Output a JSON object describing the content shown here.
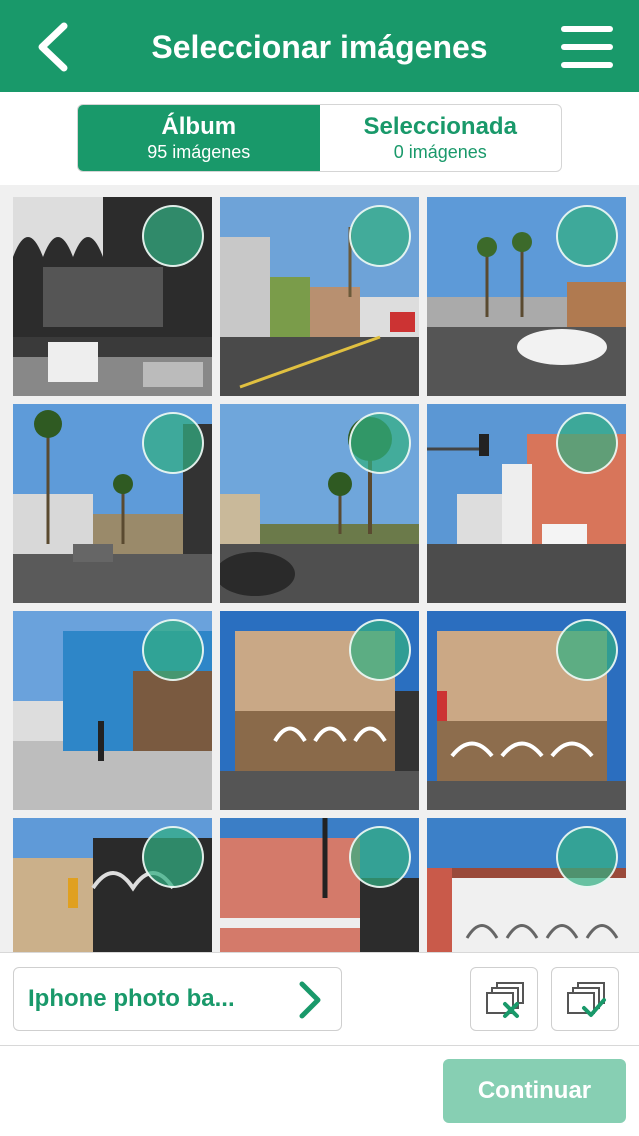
{
  "header": {
    "title": "Seleccionar imágenes",
    "background_color": "#19996a",
    "back_icon": "chevron-left-icon",
    "menu_icon": "hamburger-menu-icon"
  },
  "tabs": [
    {
      "label": "Álbum",
      "count_text": "95 imágenes",
      "active": true
    },
    {
      "label": "Seleccionada",
      "count_text": "0 imágenes",
      "active": false
    }
  ],
  "grid": {
    "thumbnails": [
      {
        "scene": "mural wall with arches and parked cars",
        "selected": false
      },
      {
        "scene": "street with palm trees and buildings",
        "selected": false
      },
      {
        "scene": "road with palm trees and white car",
        "selected": false
      },
      {
        "scene": "palm trees along street",
        "selected": false
      },
      {
        "scene": "street with palm tree and parked car",
        "selected": false
      },
      {
        "scene": "intersection with colorful buildings",
        "selected": false
      },
      {
        "scene": "blue arcade building",
        "selected": false
      },
      {
        "scene": "arched brick building",
        "selected": false
      },
      {
        "scene": "arched brick building with awning",
        "selected": false
      },
      {
        "scene": "mural building corner",
        "selected": false
      },
      {
        "scene": "red brick building",
        "selected": false
      },
      {
        "scene": "white arched building",
        "selected": false
      }
    ]
  },
  "bottom": {
    "album_button_label": "Iphone photo ba...",
    "album_chevron_icon": "chevron-right-icon",
    "deselect_all_icon": "deselect-all-icon",
    "select_all_icon": "select-all-icon",
    "continue_label": "Continuar",
    "continue_enabled": false
  },
  "colors": {
    "accent": "#19996a",
    "disabled_button": "#87cfb3",
    "selection_circle": "#32af82"
  }
}
